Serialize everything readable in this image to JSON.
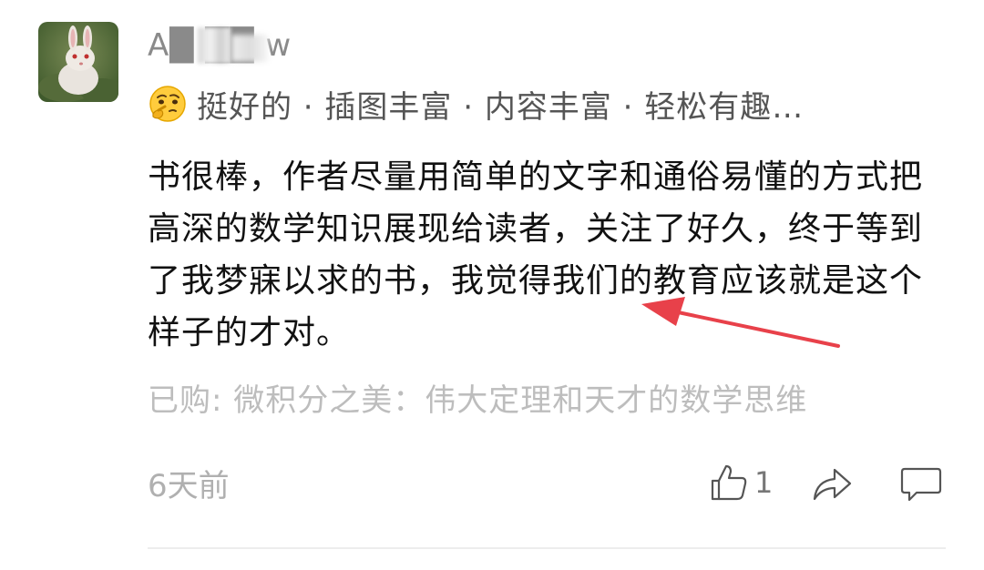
{
  "review": {
    "username": "A█ ██ w",
    "tags": "挺好的 · 插图丰富 · 内容丰富 · 轻松有趣…",
    "body": "书很棒，作者尽量用简单的文字和通俗易懂的方式把高深的数学知识展现给读者，关注了好久，终于等到了我梦寐以求的书，我觉得我们的教育应该就是这个样子的才对。",
    "purchased": "已购: 微积分之美：伟大定理和天才的数学思维",
    "time": "6天前",
    "like_count": "1"
  },
  "icons": {
    "avatar": "rabbit-avatar",
    "emoji": "thinking-face",
    "like": "thumbs-up-icon",
    "share": "share-icon",
    "comment": "comment-icon"
  },
  "colors": {
    "annotation_arrow": "#e8414a"
  }
}
